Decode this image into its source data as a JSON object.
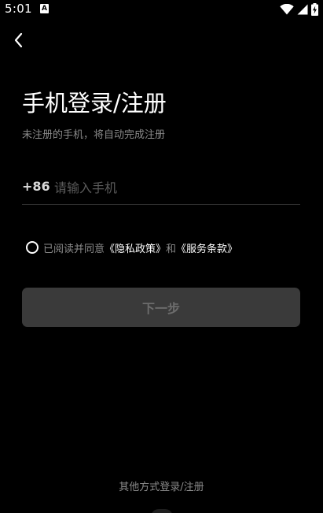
{
  "status_bar": {
    "time": "5:01",
    "notification_letter": "A",
    "icons": [
      "wifi-icon",
      "cellular-signal-icon",
      "battery-charging-icon"
    ]
  },
  "header": {
    "back_icon": "chevron-left-icon"
  },
  "main": {
    "title": "手机登录/注册",
    "subtitle": "未注册的手机，将自动完成注册",
    "phone": {
      "country_code": "+86",
      "placeholder": "请输入手机",
      "value": ""
    },
    "agreement": {
      "prefix": "已阅读并同意",
      "privacy_link": "《隐私政策》",
      "conjunction": "和",
      "terms_link": "《服务条款》",
      "checked": false
    },
    "next_button": "下一步"
  },
  "footer": {
    "other_login": "其他方式登录/注册"
  },
  "colors": {
    "background": "#000000",
    "title": "#ffffff",
    "secondary_text": "#8a8a8a",
    "button_disabled_bg": "#3a3a3a",
    "button_disabled_text": "#6c6c6c"
  }
}
